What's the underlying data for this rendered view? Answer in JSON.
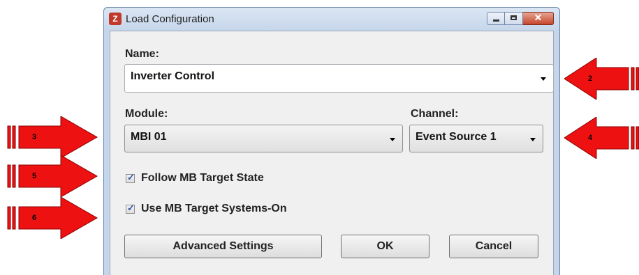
{
  "window": {
    "title": "Load Configuration",
    "icon": "cz-app-icon"
  },
  "name_field": {
    "label": "Name:",
    "value": "Inverter Control"
  },
  "module_field": {
    "label": "Module:",
    "value": "MBI 01"
  },
  "channel_field": {
    "label": "Channel:",
    "value": "Event Source 1"
  },
  "checkboxes": [
    {
      "label": "Follow MB Target State",
      "checked": true
    },
    {
      "label": "Use MB Target Systems-On",
      "checked": true
    }
  ],
  "buttons": {
    "advanced": "Advanced Settings",
    "ok": "OK",
    "cancel": "Cancel"
  },
  "callouts": [
    "2",
    "3",
    "4",
    "5",
    "6"
  ],
  "colors": {
    "callout_arrow": "#ee1111",
    "title_bar": "#c6d6ea",
    "close_button": "#c5462b"
  }
}
